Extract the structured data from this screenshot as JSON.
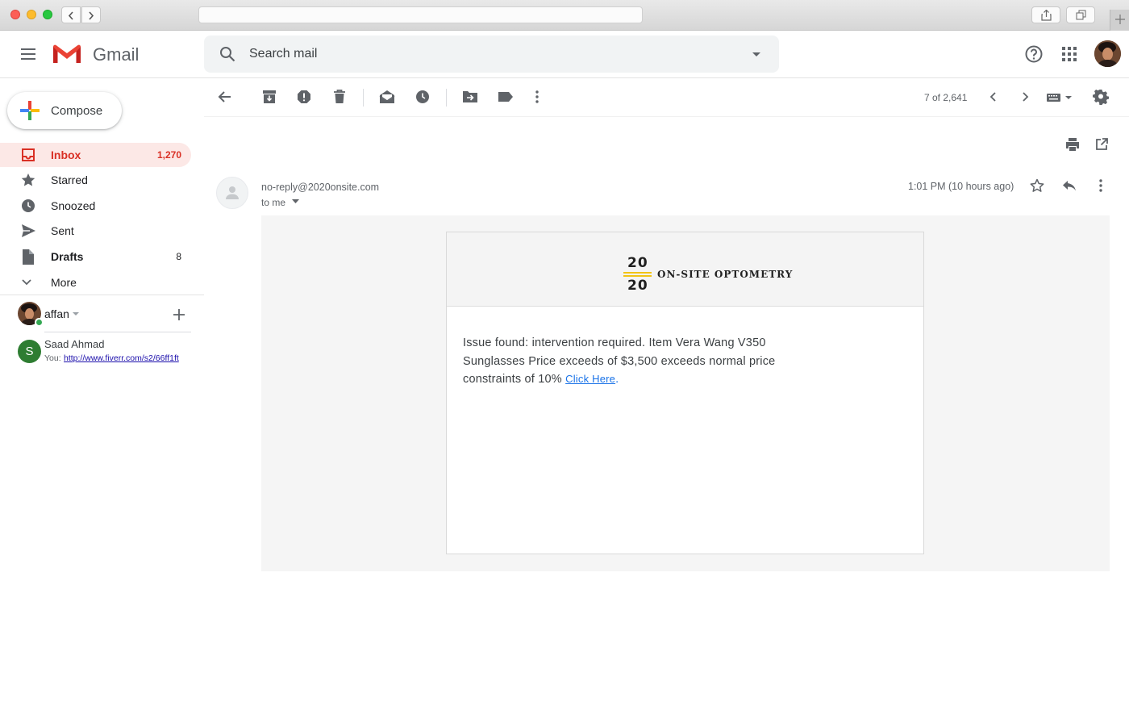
{
  "app": {
    "name": "Gmail"
  },
  "search": {
    "placeholder": "Search mail"
  },
  "compose": {
    "label": "Compose"
  },
  "nav": {
    "inbox": {
      "label": "Inbox",
      "count": "1,270"
    },
    "starred": {
      "label": "Starred"
    },
    "snoozed": {
      "label": "Snoozed"
    },
    "sent": {
      "label": "Sent"
    },
    "drafts": {
      "label": "Drafts",
      "count": "8"
    },
    "more": {
      "label": "More"
    }
  },
  "hangouts": {
    "user": "affan",
    "contact": {
      "initial": "S",
      "name": "Saad Ahmad",
      "preview_prefix": "You:",
      "preview_link": "http://www.fiverr.com/s2/66ff1ft"
    }
  },
  "toolbar": {
    "pagination": "7 of 2,641"
  },
  "email": {
    "from": "no-reply@2020onsite.com",
    "to": "to me",
    "time": "1:01 PM (10 hours ago)",
    "brand": {
      "num_top": "20",
      "num_bottom": "20",
      "name": "ON-SITE OPTOMETRY"
    },
    "body": "Issue found: intervention required. Item Vera Wang V350 Sunglasses Price exceeds of $3,500 exceeds normal price constraints of 10%",
    "link_text": "Click Here",
    "link_suffix": "."
  },
  "colors": {
    "accent_red": "#d93025",
    "inbox_bg": "#fce8e6",
    "link": "#1a73e8",
    "brand_yellow": "#f2c314"
  }
}
